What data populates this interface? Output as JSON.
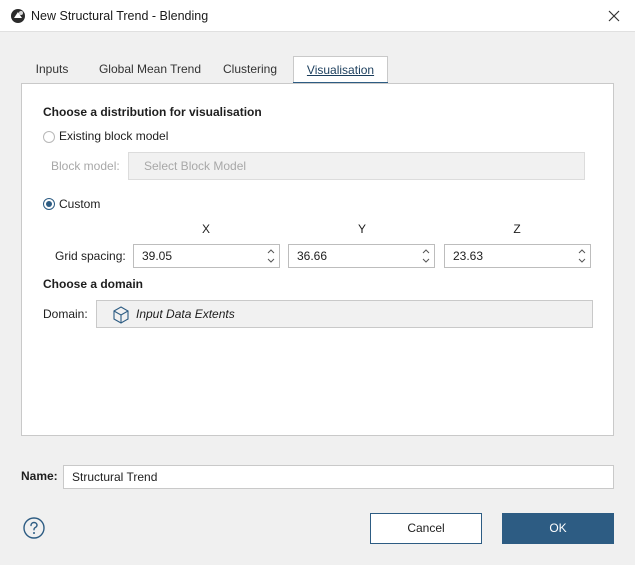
{
  "window": {
    "title": "New Structural Trend - Blending"
  },
  "tabs": [
    {
      "label": "Inputs"
    },
    {
      "label": "Global Mean Trend"
    },
    {
      "label": "Clustering"
    },
    {
      "label": "Visualisation"
    }
  ],
  "visualisation": {
    "distribution_title": "Choose a distribution for visualisation",
    "existing_block_model_label": "Existing block model",
    "block_model_label": "Block model:",
    "block_model_placeholder": "Select Block Model",
    "custom_label": "Custom",
    "axis_x": "X",
    "axis_y": "Y",
    "axis_z": "Z",
    "grid_spacing_label": "Grid spacing:",
    "grid_spacing_x": "39.05",
    "grid_spacing_y": "36.66",
    "grid_spacing_z": "23.63",
    "domain_title": "Choose a domain",
    "domain_label": "Domain:",
    "domain_value": "Input Data Extents",
    "selected_distribution": "Custom"
  },
  "footer": {
    "name_label": "Name:",
    "name_value": "Structural Trend",
    "cancel_label": "Cancel",
    "ok_label": "OK"
  },
  "icons": {
    "app": "app-logo-icon",
    "close": "close-icon",
    "domain": "cube-icon",
    "help": "help-icon"
  },
  "colors": {
    "accent": "#2d5c83",
    "disabled_text": "#a8a8a8",
    "panel_bg": "#ffffff",
    "window_bg": "#f0f0f0"
  }
}
